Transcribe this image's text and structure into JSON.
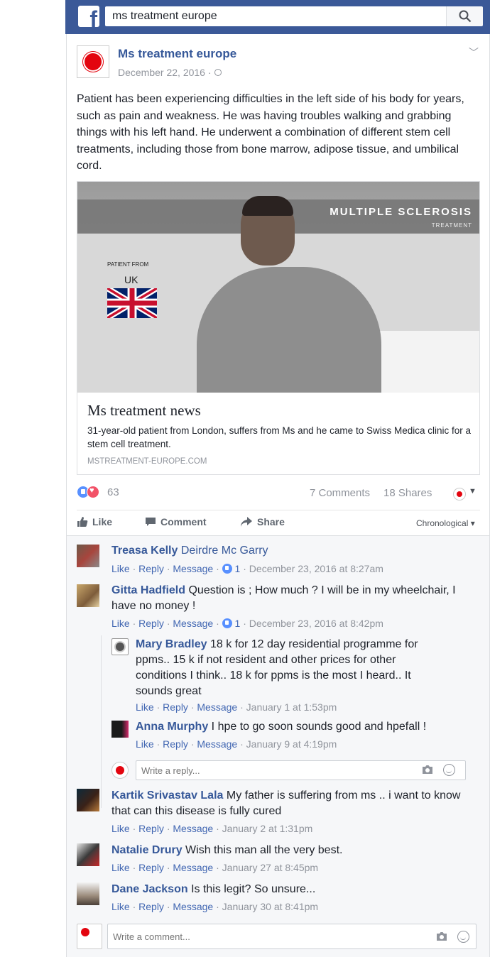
{
  "search": {
    "query": "ms treatment europe"
  },
  "post": {
    "author": "Ms treatment europe",
    "date": "December 22, 2016 ·",
    "text": "Patient has been experiencing difficulties in the left side of his body for years, such as pain and weakness. He was having troubles walking and grabbing things with his left hand. He underwent a combination of different stem cell treatments, including those from bone marrow, adipose tissue, and umbilical cord."
  },
  "link": {
    "image_title": "MULTIPLE SCLEROSIS",
    "image_subtitle": "TREATMENT",
    "image_patient_from": "PATIENT FROM",
    "image_country": "UK",
    "title": "Ms treatment news",
    "description": "31-year-old patient from London, suffers from Ms and he came to Swiss Medica clinic for a stem cell treatment.",
    "domain": "MSTREATMENT-EUROPE.COM"
  },
  "stats": {
    "reactions": "63",
    "comments": "7 Comments",
    "shares": "18 Shares"
  },
  "actions": {
    "like": "Like",
    "comment": "Comment",
    "share": "Share",
    "order": "Chronological ▾"
  },
  "colors": {
    "brand": "#3b5998",
    "link": "#365899",
    "meta": "#90949c",
    "background": "#f6f7f9"
  },
  "comments": [
    {
      "name": "Treasa Kelly",
      "text": "Deirdre Mc Garry",
      "meta_likes": "1",
      "time": "December 23, 2016 at 8:27am"
    },
    {
      "name": "Gitta Hadfield",
      "text": "Question is ; How much ? I will be in my wheelchair, I have no money !",
      "meta_likes": "1",
      "time": "December 23, 2016 at 8:42pm"
    },
    {
      "name": "Kartik Srivastav Lala",
      "text": "My father is suffering from ms .. i want to know that can this disease is fully cured",
      "time": "January 2 at 1:31pm"
    },
    {
      "name": "Natalie Drury",
      "text": "Wish this man all the very best.",
      "time": "January 27 at 8:45pm"
    },
    {
      "name": "Dane Jackson",
      "text": "Is this legit? So unsure...",
      "time": "January 30 at 8:41pm"
    }
  ],
  "replies": [
    {
      "name": "Mary Bradley",
      "text": "18 k for 12 day residential programme for ppms.. 15 k if not resident and other prices for other conditions I think.. 18 k for ppms is the most I heard.. It sounds great",
      "time": "January 1 at 1:53pm"
    },
    {
      "name": "Anna Murphy",
      "text": "I hpe to go soon sounds good and hpefall !",
      "time": "January 9 at 4:19pm"
    }
  ],
  "meta_links": {
    "like": "Like",
    "reply": "Reply",
    "message": "Message"
  },
  "reply_placeholder": "Write a reply...",
  "comment_placeholder": "Write a comment..."
}
